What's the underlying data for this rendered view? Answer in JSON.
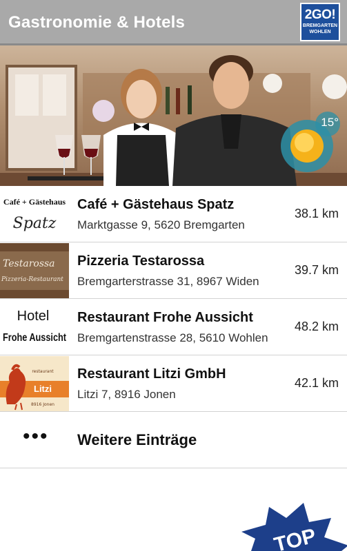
{
  "header": {
    "title": "Gastronomie & Hotels",
    "logo": {
      "line1": "2GO!",
      "line2": "BREMGARTEN",
      "line3": "WOHLEN"
    }
  },
  "weather": {
    "temperature": "15°",
    "icon": "sun-icon"
  },
  "entries": [
    {
      "name": "Café + Gästehaus Spatz",
      "address": "Marktgasse 9, 5620 Bremgarten",
      "distance": "38.1 km",
      "thumb": {
        "line1": "Café + Gästehaus",
        "line2": "Spatz"
      }
    },
    {
      "name": "Pizzeria Testarossa",
      "address": "Bremgarterstrasse  31, 8967 Widen",
      "distance": "39.7 km",
      "thumb": {
        "line1": "Testarossa",
        "line2": "Pizzeria-Restaurant"
      }
    },
    {
      "name": "Restaurant Frohe Aussicht",
      "address": "Bremgartenstrasse 28, 5610 Wohlen",
      "distance": "48.2 km",
      "thumb": {
        "line1": "Hotel",
        "line2": "Frohe Aussicht"
      }
    },
    {
      "name": "Restaurant Litzi GmbH",
      "address": "Litzi 7, 8916 Jonen",
      "distance": "42.1 km",
      "thumb": {
        "line1": "restaurant",
        "line2": "Litzi",
        "line3": "8916 Jonen"
      }
    }
  ],
  "more": {
    "label": "Weitere Einträge",
    "dots": "•••"
  },
  "badge": {
    "label": "TOP"
  }
}
